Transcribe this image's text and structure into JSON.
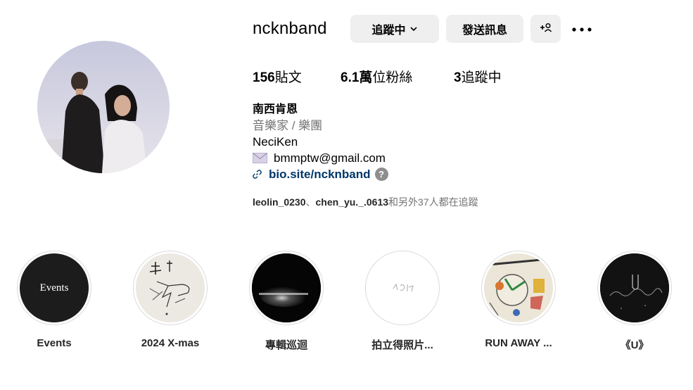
{
  "profile": {
    "username": "ncknband",
    "avatar_icon": "band-photo-avatar"
  },
  "actions": {
    "following_label": "追蹤中",
    "message_label": "發送訊息",
    "add_user_icon": "add-user-icon",
    "more_icon": "more-options-icon"
  },
  "stats": {
    "posts_count": "156",
    "posts_label": "貼文",
    "followers_count": "6.1萬",
    "followers_label": "位粉絲",
    "following_count": "3",
    "following_label": "追蹤中"
  },
  "bio": {
    "name": "南西肯恩",
    "category": "音樂家 / 樂團",
    "line1": "NeciKen",
    "email": "bmmptw@gmail.com",
    "link": "bio.site/ncknband",
    "help_mark": "?"
  },
  "followed_by": {
    "user1": "leolin_0230",
    "separator": "、",
    "user2": "chen_yu._.0613",
    "suffix": "和另外37人都在追蹤"
  },
  "highlights": [
    {
      "label": "Events",
      "cover_text": "Events"
    },
    {
      "label": "2024 X-mas"
    },
    {
      "label": "專輯巡迴"
    },
    {
      "label": "拍立得照片..."
    },
    {
      "label": "RUN AWAY ..."
    },
    {
      "label": "《U》"
    }
  ],
  "colors": {
    "button_bg": "#efefef",
    "link": "#00376b",
    "secondary_text": "#737373",
    "ring": "#dbdbdb"
  }
}
